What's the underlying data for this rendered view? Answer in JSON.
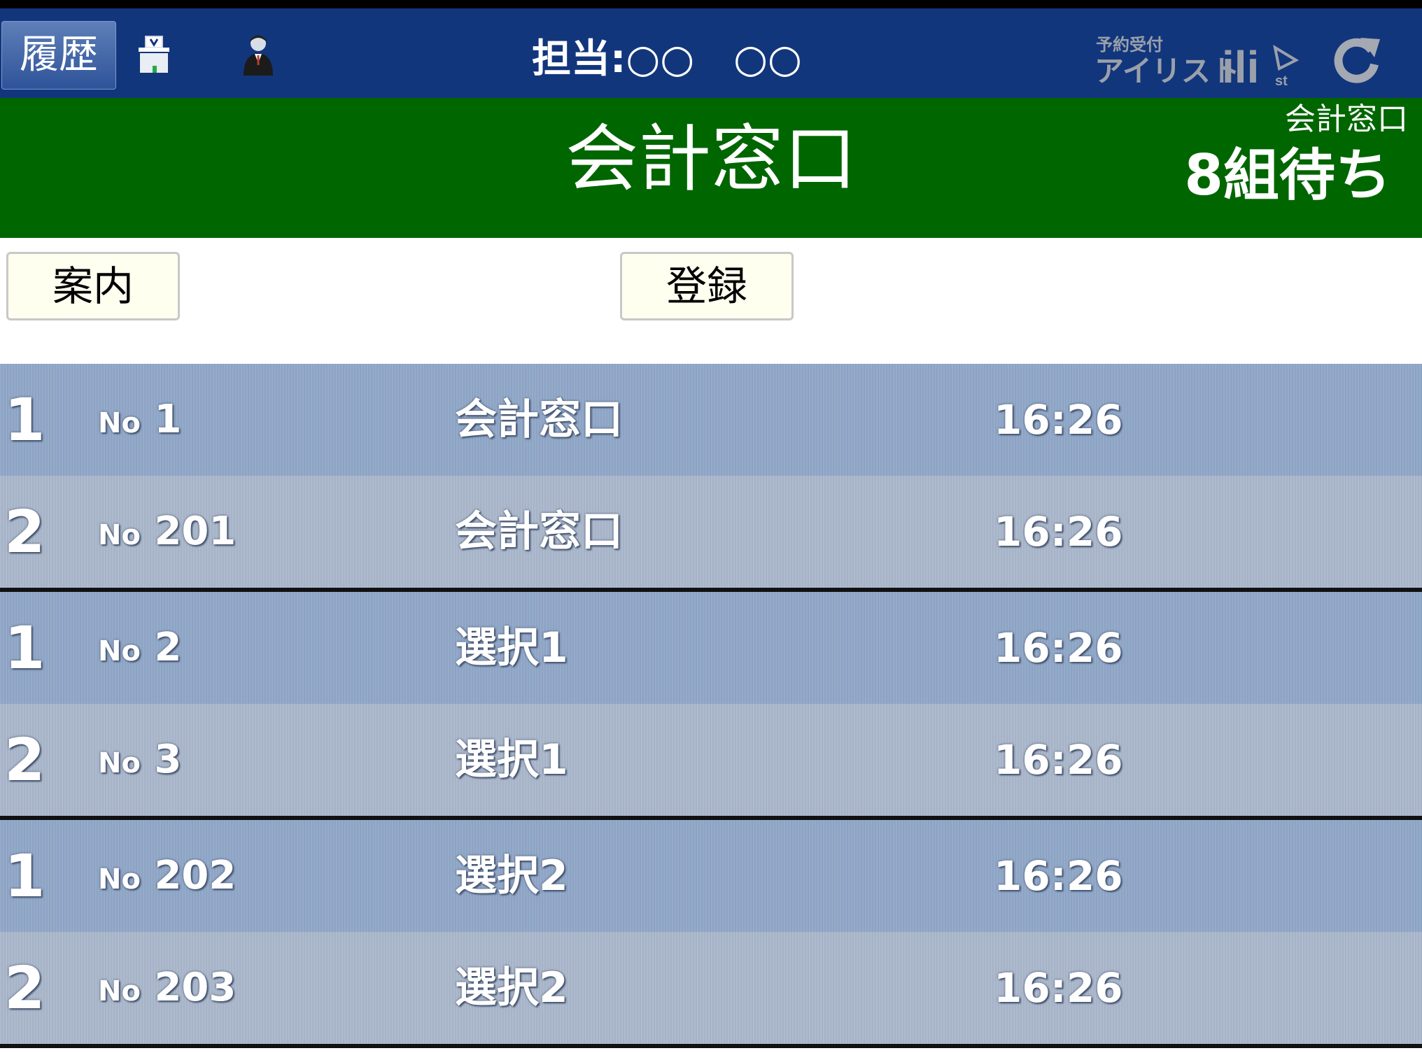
{
  "header": {
    "history_label": "履歴",
    "staff_label": "担当:○○　○○",
    "brand_text_small": "予約受付",
    "brand_text_large": "アイリスト",
    "brand_mark": "ili",
    "brand_mark_sub": "st",
    "icons": [
      "ballot-box-icon",
      "staff-person-icon",
      "refresh-icon"
    ],
    "colors": {
      "background": "#12367c",
      "button": "#3a5fa3"
    }
  },
  "banner": {
    "title": "会計窓口",
    "sub_label": "会計窓口",
    "waiting": "8組待ち",
    "color": "#006600"
  },
  "actions": {
    "guide_label": "案内",
    "register_label": "登録"
  },
  "queue": {
    "no_prefix": "No",
    "groups": [
      {
        "rows": [
          {
            "order": "1",
            "number": "1",
            "counter": "会計窓口",
            "time": "16:26"
          },
          {
            "order": "2",
            "number": "201",
            "counter": "会計窓口",
            "time": "16:26"
          }
        ]
      },
      {
        "rows": [
          {
            "order": "1",
            "number": "2",
            "counter": "選択1",
            "time": "16:26"
          },
          {
            "order": "2",
            "number": "3",
            "counter": "選択1",
            "time": "16:26"
          }
        ]
      },
      {
        "rows": [
          {
            "order": "1",
            "number": "202",
            "counter": "選択2",
            "time": "16:26"
          },
          {
            "order": "2",
            "number": "203",
            "counter": "選択2",
            "time": "16:26"
          }
        ]
      }
    ],
    "row_colors": [
      "#8fa6c7",
      "#a9b6ca"
    ]
  }
}
